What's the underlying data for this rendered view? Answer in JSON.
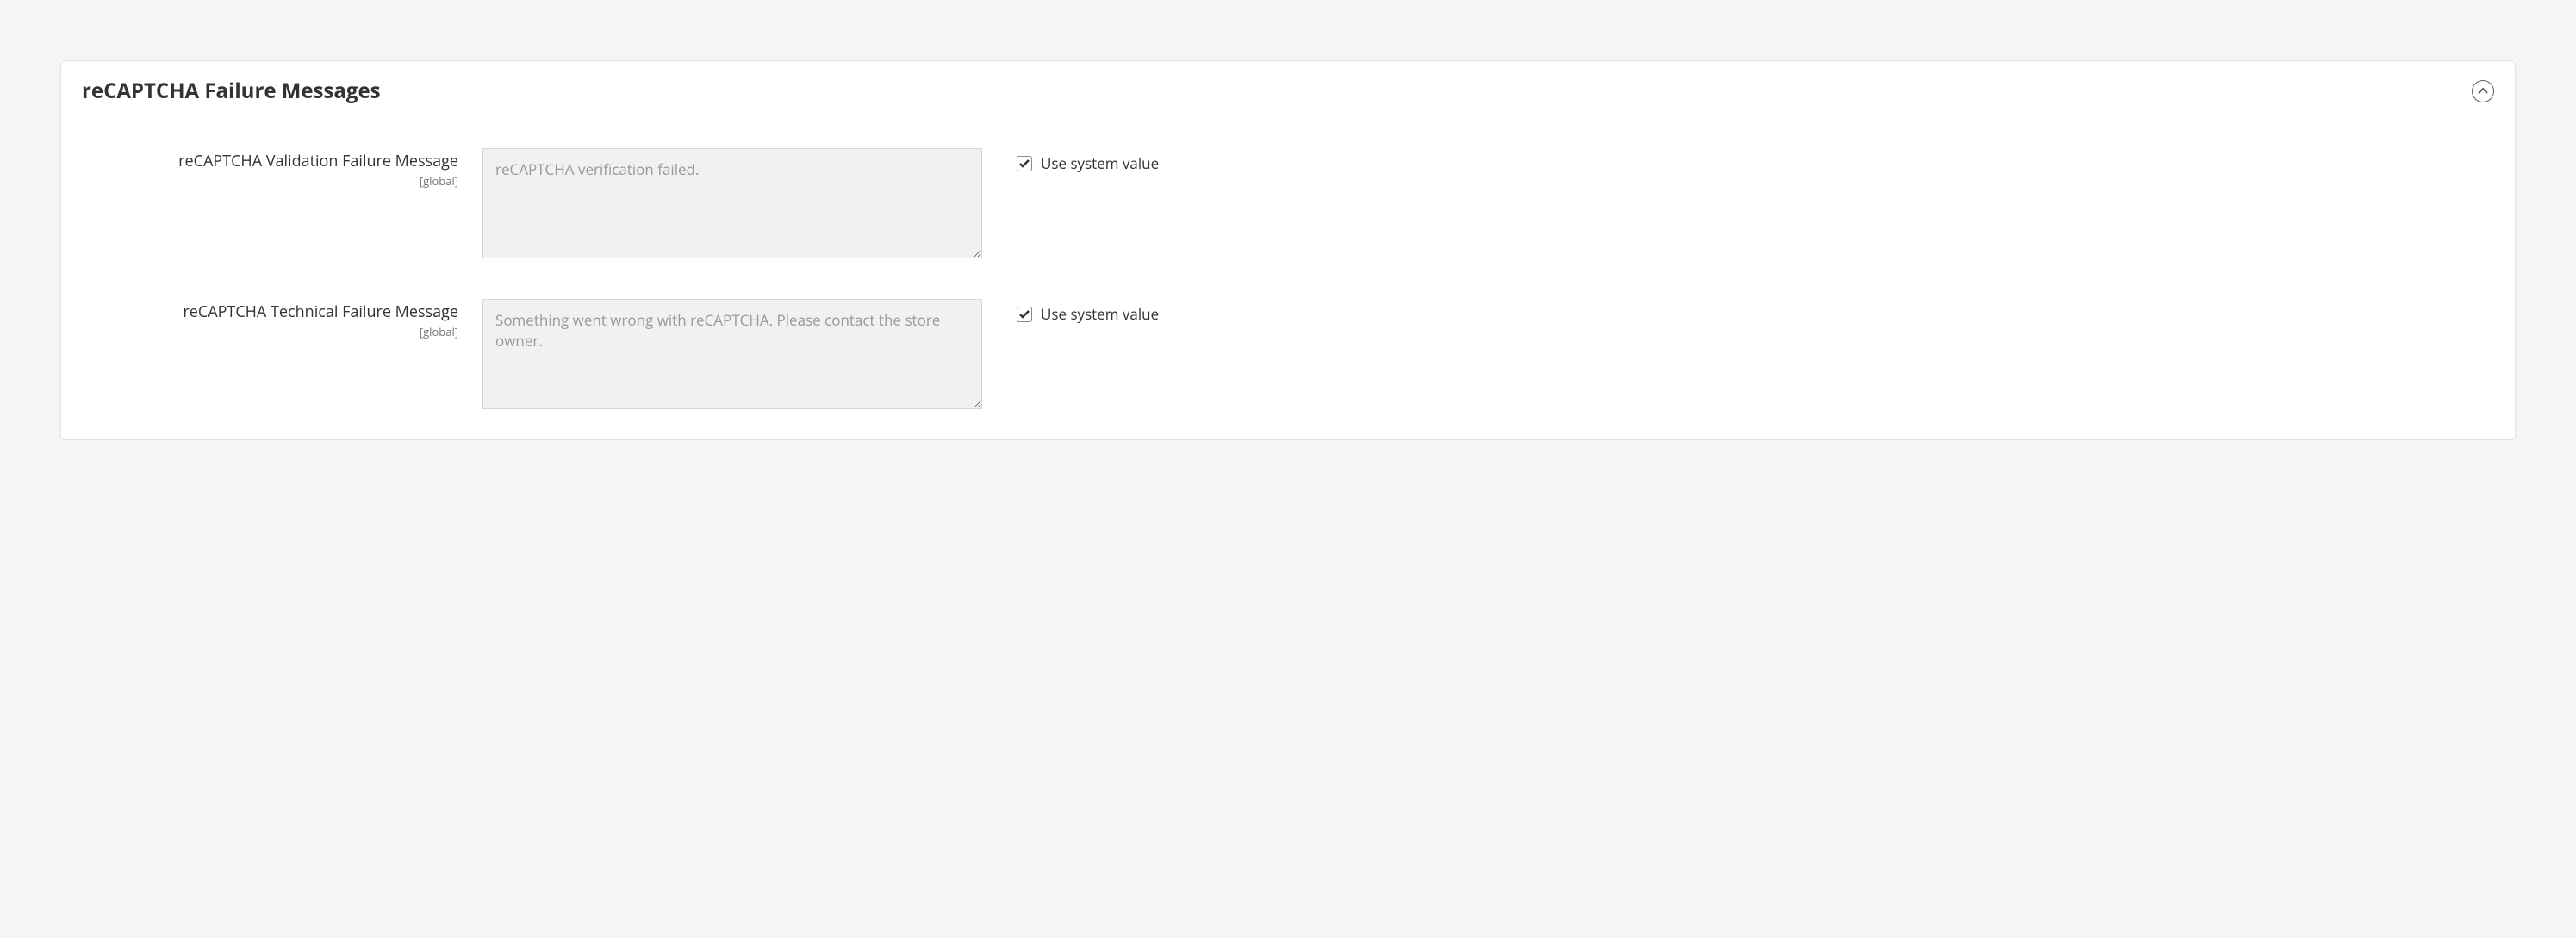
{
  "section": {
    "title": "reCAPTCHA Failure Messages"
  },
  "fields": [
    {
      "label": "reCAPTCHA Validation Failure Message",
      "scope": "[global]",
      "value": "reCAPTCHA verification failed.",
      "use_system_label": "Use system value",
      "use_system_checked": true
    },
    {
      "label": "reCAPTCHA Technical Failure Message",
      "scope": "[global]",
      "value": "Something went wrong with reCAPTCHA. Please contact the store owner.",
      "use_system_label": "Use system value",
      "use_system_checked": true
    }
  ]
}
